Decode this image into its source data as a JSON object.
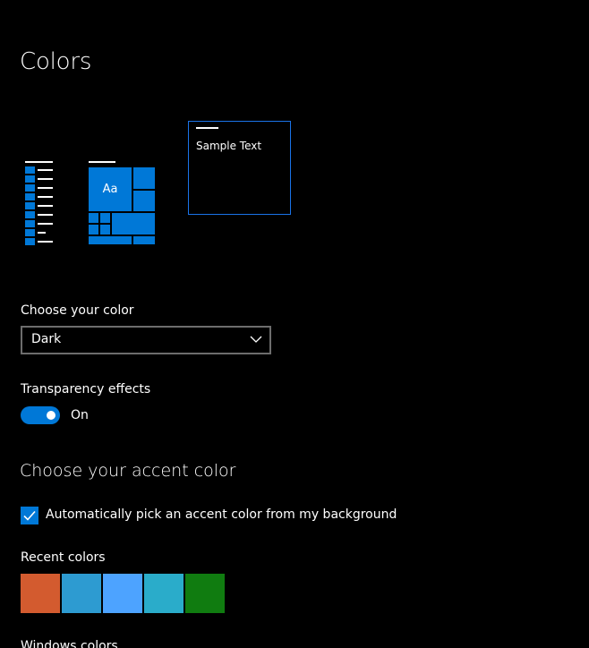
{
  "page": {
    "title": "Colors"
  },
  "preview": {
    "sample_text": "Sample Text",
    "tile_text": "Aa",
    "accent_color": "#0078d7"
  },
  "choose_color": {
    "label": "Choose your color",
    "selected": "Dark"
  },
  "transparency": {
    "label": "Transparency effects",
    "state": "On",
    "enabled": true
  },
  "accent": {
    "heading": "Choose your accent color",
    "auto_pick_label": "Automatically pick an accent color from my background",
    "auto_pick_checked": true
  },
  "recent_colors": {
    "label": "Recent colors",
    "swatches": [
      "#d35b2f",
      "#2d9bd1",
      "#4da3ff",
      "#2aacca",
      "#107c10"
    ]
  },
  "next_section": {
    "label": "Windows colors"
  }
}
